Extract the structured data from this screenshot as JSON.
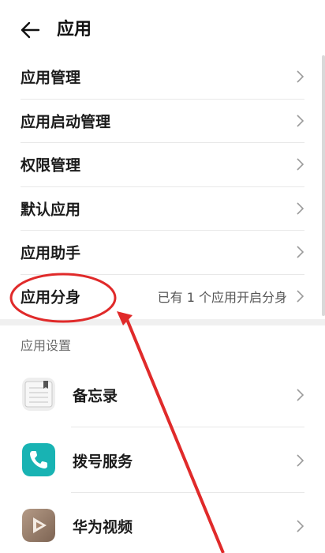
{
  "header": {
    "title": "应用",
    "back_icon": "arrow-left-icon"
  },
  "menu": {
    "items": [
      {
        "label": "应用管理",
        "value": ""
      },
      {
        "label": "应用启动管理",
        "value": ""
      },
      {
        "label": "权限管理",
        "value": ""
      },
      {
        "label": "默认应用",
        "value": ""
      },
      {
        "label": "应用助手",
        "value": ""
      },
      {
        "label": "应用分身",
        "value": "已有 1 个应用开启分身"
      }
    ]
  },
  "section": {
    "title": "应用设置"
  },
  "apps": [
    {
      "name": "备忘录",
      "icon": "notepad-icon"
    },
    {
      "name": "拨号服务",
      "icon": "phone-icon"
    },
    {
      "name": "华为视频",
      "icon": "video-icon"
    }
  ],
  "colors": {
    "annotation": "#e02a2a",
    "phone_icon_bg": "#18b3b3",
    "video_icon_bg": "#9a7f6c"
  }
}
